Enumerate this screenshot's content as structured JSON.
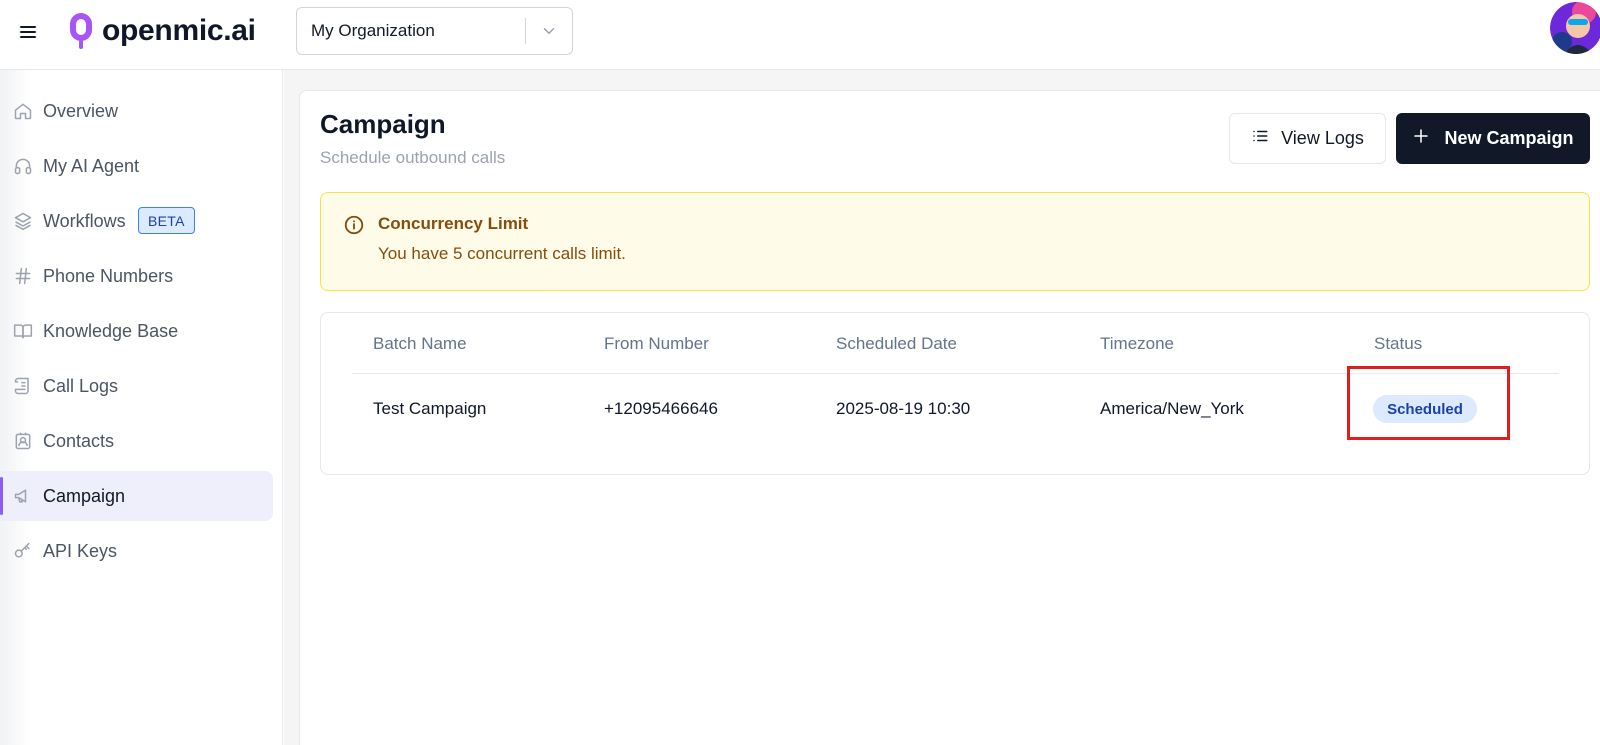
{
  "header": {
    "logo_text": "openmic.ai",
    "org_selector": {
      "value": "My Organization"
    }
  },
  "sidebar": {
    "items": [
      {
        "label": "Overview",
        "icon": "home-icon"
      },
      {
        "label": "My AI Agent",
        "icon": "headphones-icon"
      },
      {
        "label": "Workflows",
        "icon": "layers-icon",
        "badge": "BETA"
      },
      {
        "label": "Phone Numbers",
        "icon": "hash-icon"
      },
      {
        "label": "Knowledge Base",
        "icon": "book-icon"
      },
      {
        "label": "Call Logs",
        "icon": "scroll-icon"
      },
      {
        "label": "Contacts",
        "icon": "contact-icon"
      },
      {
        "label": "Campaign",
        "icon": "megaphone-icon",
        "active": true
      },
      {
        "label": "API Keys",
        "icon": "key-icon"
      }
    ]
  },
  "page": {
    "title": "Campaign",
    "subtitle": "Schedule outbound calls",
    "view_logs_label": "View Logs",
    "new_campaign_label": "New Campaign"
  },
  "alert": {
    "title": "Concurrency Limit",
    "message": "You have 5 concurrent calls limit."
  },
  "table": {
    "columns": [
      "Batch Name",
      "From Number",
      "Scheduled Date",
      "Timezone",
      "Status"
    ],
    "rows": [
      {
        "batch_name": "Test Campaign",
        "from_number": "+12095466646",
        "scheduled_date": "2025-08-19 10:30",
        "timezone": "America/New_York",
        "status": "Scheduled"
      }
    ]
  },
  "colors": {
    "accent": "#8b5cf6",
    "primary_button": "#111827",
    "alert_background": "#fefce8",
    "alert_text": "#854d0e",
    "status_scheduled_bg": "#dbeafe",
    "status_scheduled_text": "#1e40af",
    "highlight": "#e11d1d"
  }
}
